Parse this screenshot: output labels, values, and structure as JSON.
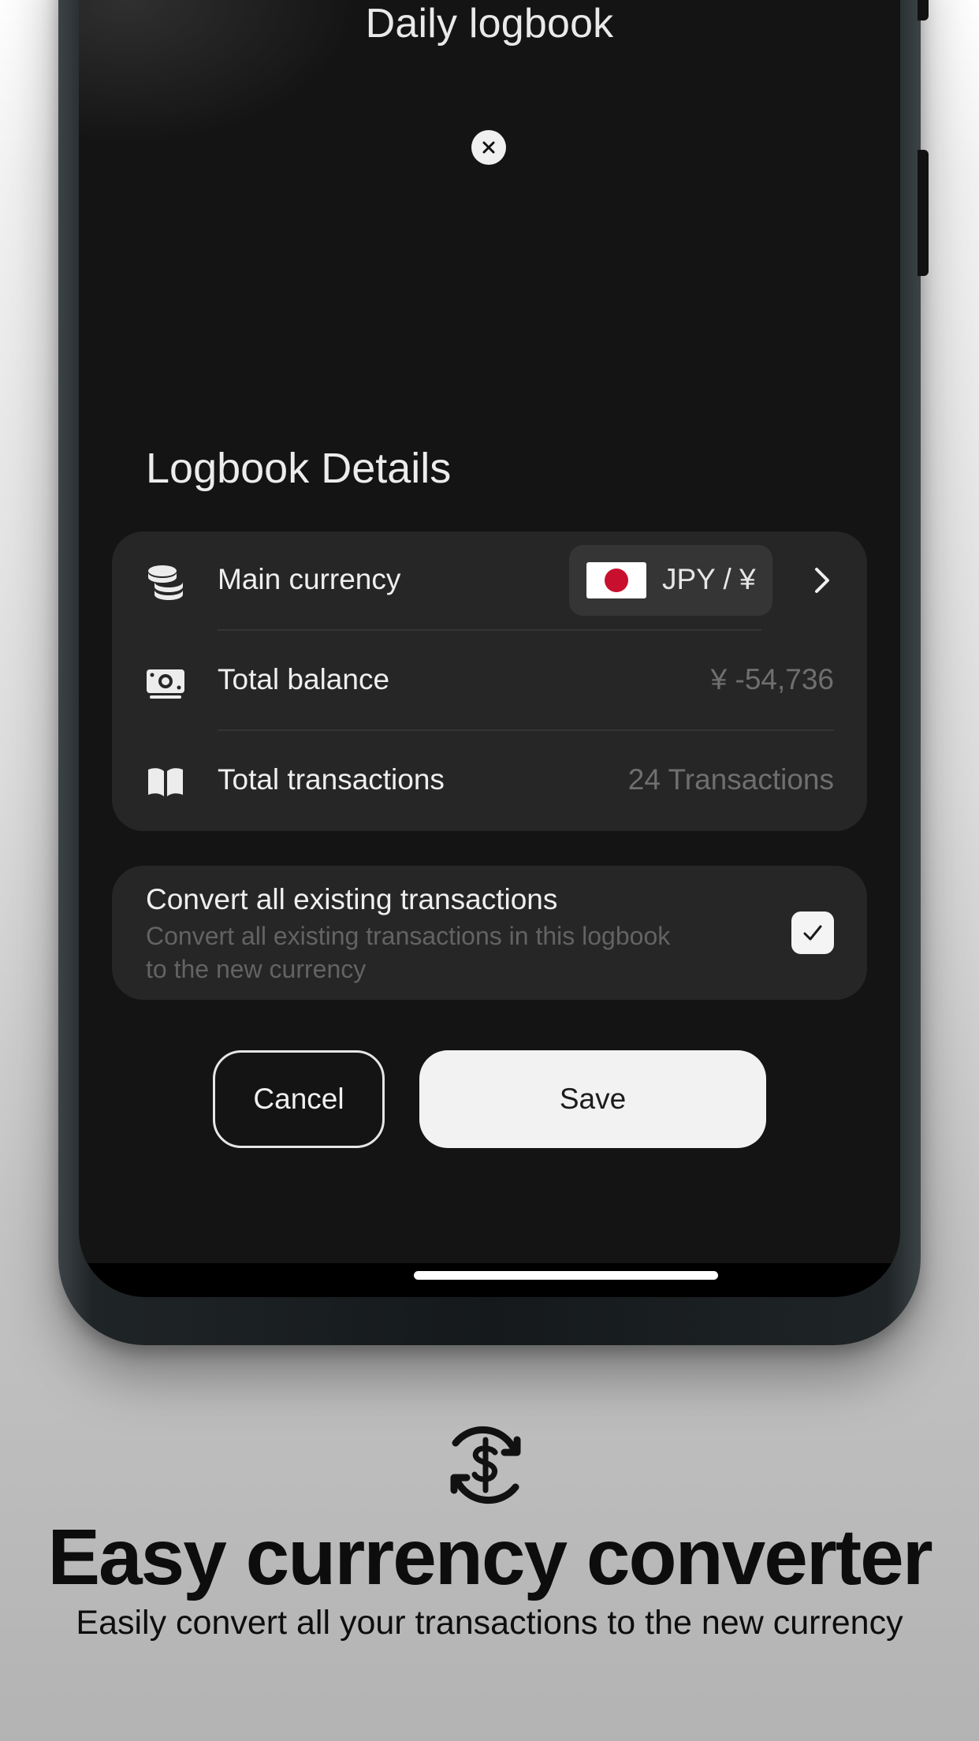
{
  "sheet": {
    "title": "Daily logbook"
  },
  "details": {
    "section_title": "Logbook Details",
    "main_currency": {
      "label": "Main currency",
      "icon": "coins-icon",
      "chip_text": "JPY / ¥",
      "flag": "japan-flag-icon"
    },
    "total_balance": {
      "label": "Total balance",
      "icon": "banknote-icon",
      "value": "¥ -54,736"
    },
    "total_transactions": {
      "label": "Total transactions",
      "icon": "book-icon",
      "value": "24 Transactions"
    }
  },
  "convert": {
    "title": "Convert all existing transactions",
    "description": "Convert all existing transactions in this logbook to the new currency",
    "checked": true
  },
  "actions": {
    "cancel_label": "Cancel",
    "save_label": "Save"
  },
  "promo": {
    "icon": "currency-exchange-icon",
    "headline": "Easy currency converter",
    "subtitle": "Easily convert all your transactions to the new currency"
  },
  "colors": {
    "screen_bg": "#141414",
    "card_bg": "#262626",
    "muted_text": "#6f6f6f",
    "flag_red": "#c8102e"
  }
}
